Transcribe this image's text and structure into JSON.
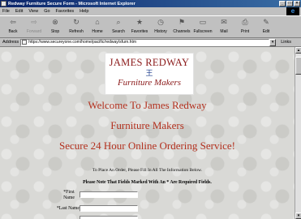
{
  "window": {
    "title": "Redway Furniture Secure Form - Microsoft Internet Explorer",
    "controls": [
      "_",
      "□",
      "×"
    ]
  },
  "menu": [
    "File",
    "Edit",
    "View",
    "Go",
    "Favorites",
    "Help"
  ],
  "toolbar": [
    {
      "label": "Back",
      "icon": "back-arrow-icon",
      "glyph": "⇦",
      "enabled": true
    },
    {
      "label": "Forward",
      "icon": "forward-arrow-icon",
      "glyph": "⇨",
      "enabled": false
    },
    {
      "label": "Stop",
      "icon": "stop-icon",
      "glyph": "⊗",
      "enabled": true
    },
    {
      "label": "Refresh",
      "icon": "refresh-icon",
      "glyph": "↻",
      "enabled": true
    },
    {
      "label": "Home",
      "icon": "home-icon",
      "glyph": "⌂",
      "enabled": true
    },
    {
      "label": "Search",
      "icon": "search-icon",
      "glyph": "⌕",
      "enabled": true
    },
    {
      "label": "Favorites",
      "icon": "favorites-icon",
      "glyph": "★",
      "enabled": true
    },
    {
      "label": "History",
      "icon": "history-icon",
      "glyph": "◷",
      "enabled": true
    },
    {
      "label": "Channels",
      "icon": "channels-icon",
      "glyph": "⚑",
      "enabled": true
    },
    {
      "label": "Fullscreen",
      "icon": "fullscreen-icon",
      "glyph": "▭",
      "enabled": true
    },
    {
      "label": "Mail",
      "icon": "mail-icon",
      "glyph": "✉",
      "enabled": true
    },
    {
      "label": "Print",
      "icon": "print-icon",
      "glyph": "⎙",
      "enabled": true
    },
    {
      "label": "Edit",
      "icon": "edit-icon",
      "glyph": "✎",
      "enabled": true
    }
  ],
  "address": {
    "label": "Address",
    "url": "https://www.secureyone.com/home/pacific/redway/sfurn.htm",
    "links_label": "Links"
  },
  "page": {
    "logo": {
      "name": "JAMES REDWAY",
      "glyph": "王",
      "sub": "Furniture Makers"
    },
    "welcome_1": "Welcome To James Redway",
    "welcome_2": "Furniture Makers",
    "welcome_3": "Secure 24 Hour Online Ordering Service!",
    "instruction": "To Place An Order, Please Fill In All The Information Below.",
    "required_note": "Please Note That Fields Marked With An * Are Required Fields.",
    "fields": {
      "first_name_label": "*First Name",
      "last_name_label": "*Last Name",
      "first_name_value": "",
      "last_name_value": ""
    }
  },
  "colors": {
    "heading_red": "#b3311f",
    "logo_red": "#8b1a1a",
    "logo_blue": "#1a3a8a",
    "titlebar_start": "#0a246a",
    "titlebar_end": "#3a6ea5"
  }
}
